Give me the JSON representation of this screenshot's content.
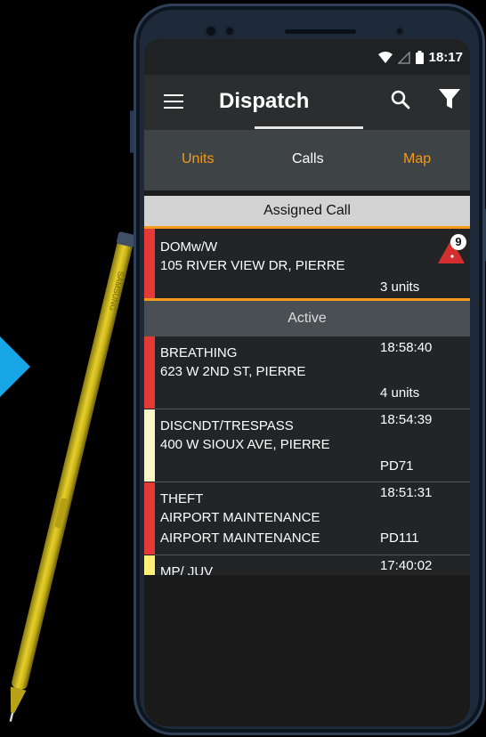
{
  "colors": {
    "accent": "#f59a1b",
    "priority_red": "#e53935",
    "priority_yellow": "#fff176",
    "priority_lightyellow": "#fbf6c8",
    "arrow_blue": "#17a6e6"
  },
  "status_bar": {
    "time": "18:17",
    "icons": [
      "wifi-icon",
      "signal-icon",
      "battery-icon"
    ]
  },
  "app_bar": {
    "title": "Dispatch",
    "icons": [
      "menu-icon",
      "search-icon",
      "filter-icon"
    ]
  },
  "tabs": [
    {
      "label": "Units",
      "state": "inactive"
    },
    {
      "label": "Calls",
      "state": "selected"
    },
    {
      "label": "Map",
      "state": "inactive"
    }
  ],
  "assigned": {
    "header": "Assigned Call",
    "call": {
      "type": "DOMw/W",
      "address": "105 RIVER VIEW DR, PIERRE",
      "units": "3 units",
      "badge_count": "9",
      "priority": "red"
    }
  },
  "active": {
    "header": "Active",
    "calls": [
      {
        "type": "BREATHING",
        "address": "623 W 2ND ST, PIERRE",
        "time": "18:58:40",
        "units": "4 units",
        "priority": "red"
      },
      {
        "type": "DISCNDT/TRESPASS",
        "address": "400 W SIOUX AVE, PIERRE",
        "time": "18:54:39",
        "units": "PD71",
        "priority": "lightyellow"
      },
      {
        "type": "THEFT",
        "address": "AIRPORT MAINTENANCE",
        "address2": "AIRPORT MAINTENANCE",
        "time": "18:51:31",
        "units": "PD111",
        "priority": "red"
      },
      {
        "type": "MP/ JUV",
        "time": "17:40:02",
        "priority": "yellow"
      }
    ]
  },
  "pen": {
    "brand": "SAMSUNG"
  }
}
